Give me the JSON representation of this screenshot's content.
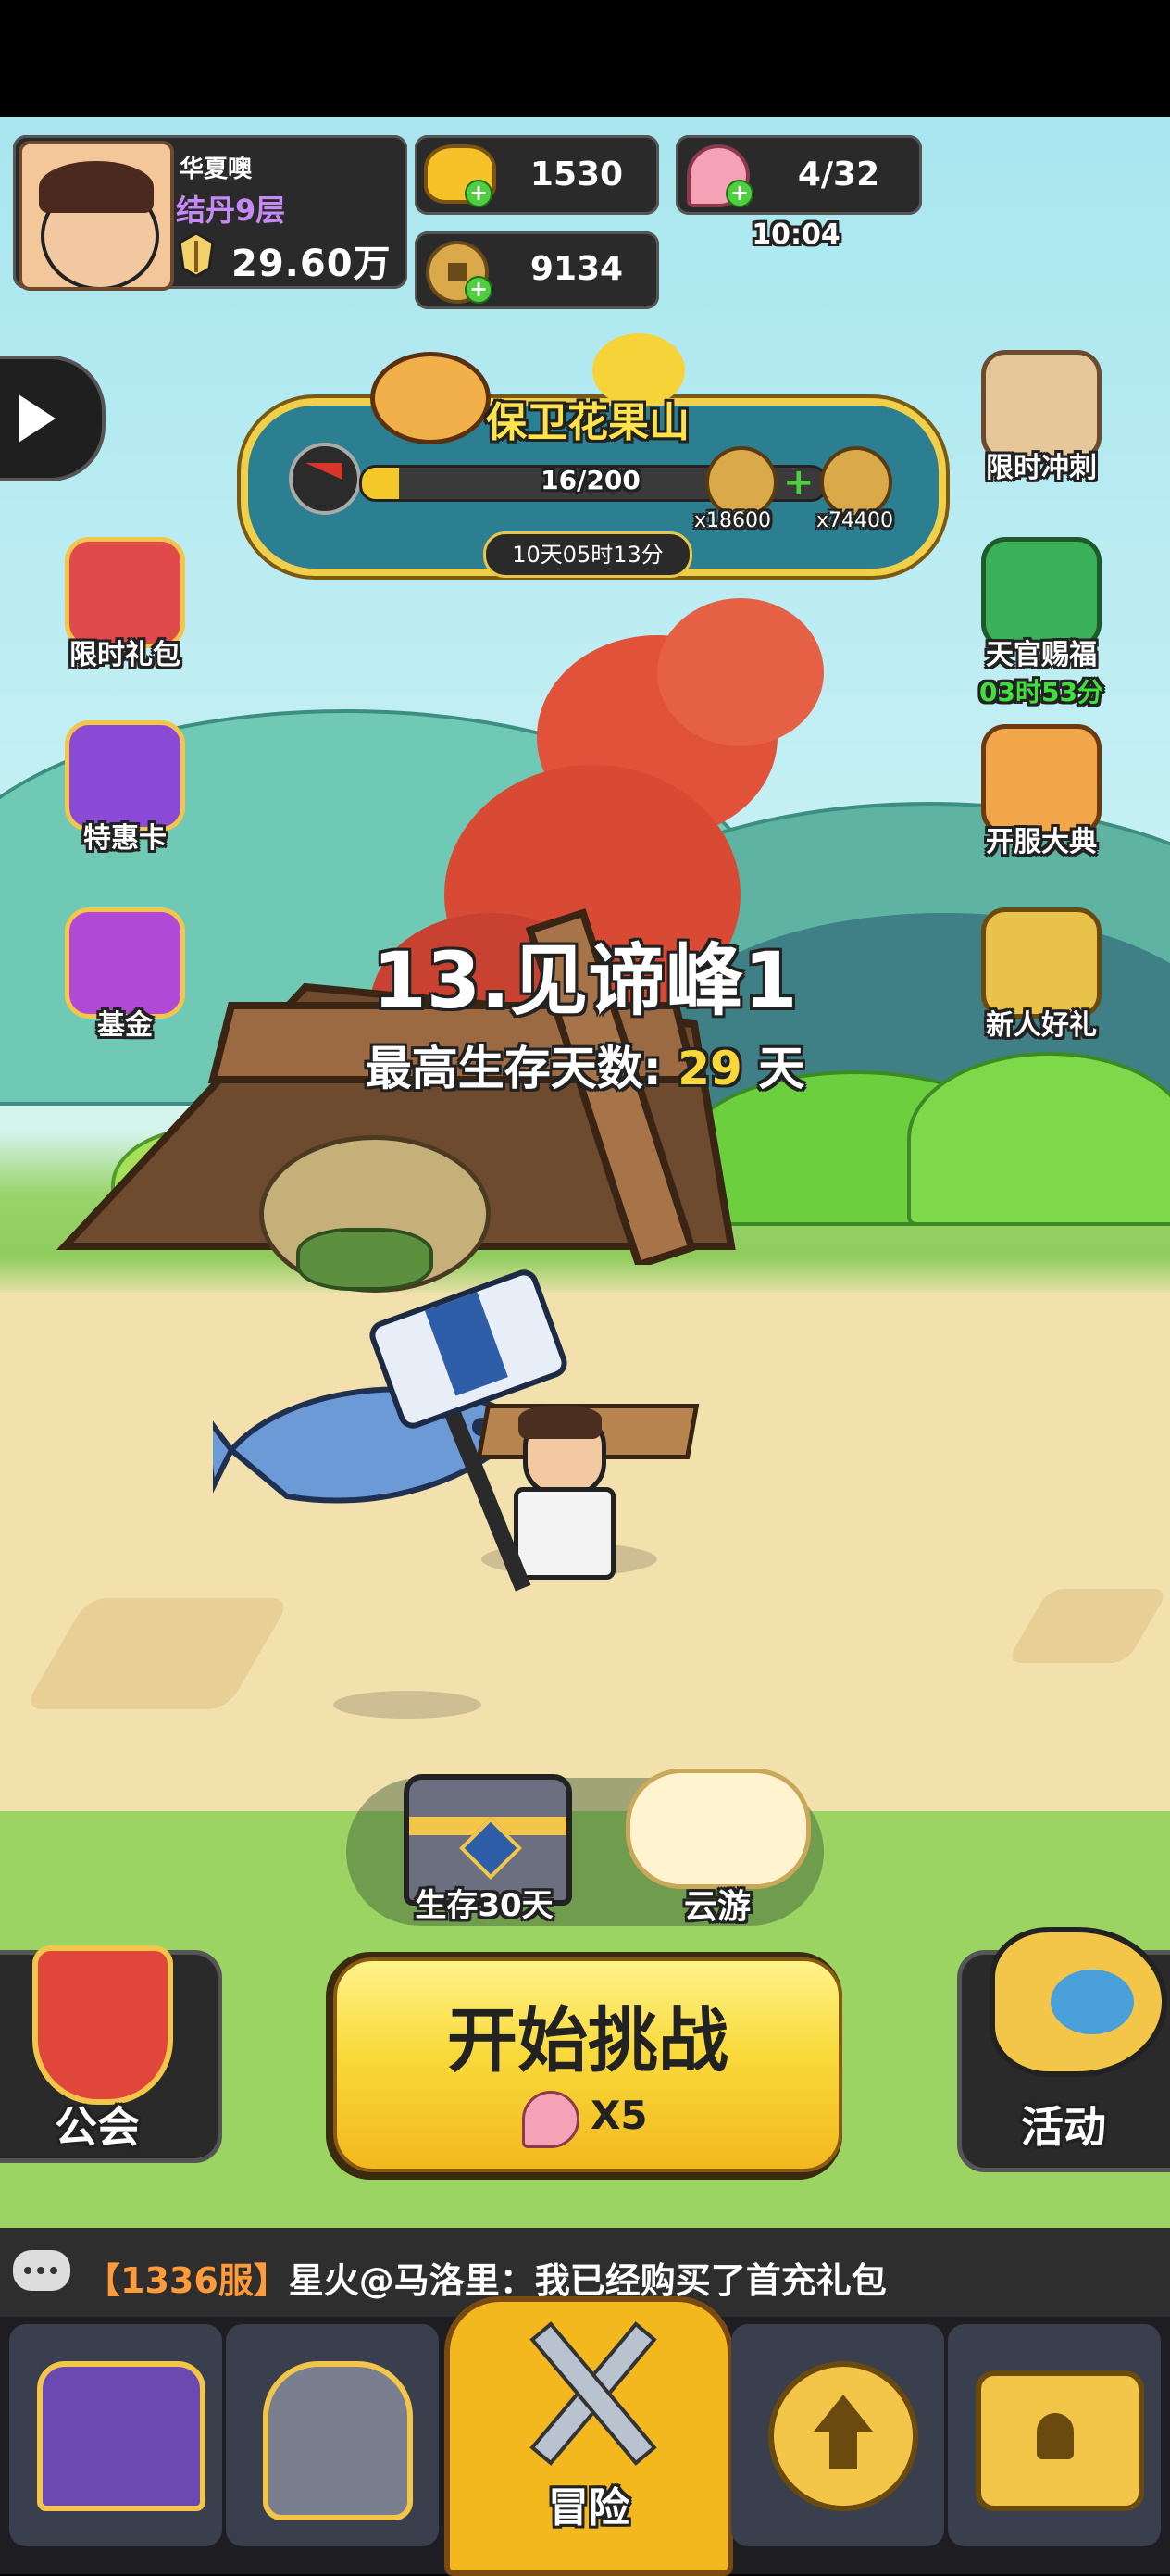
{
  "player": {
    "name": "华夏噢",
    "realm": "结丹9层",
    "power": "29.60万"
  },
  "resources": {
    "ingot": "1530",
    "coin": "9134",
    "peach": "4/32",
    "peach_timer": "10:04"
  },
  "event": {
    "title": "保卫花果山",
    "progress_text": "16/200",
    "progress": 0.08,
    "reward1": "x18600",
    "reward2": "x74400",
    "countdown": "10天05时13分"
  },
  "left_buttons": [
    {
      "label": "限时礼包"
    },
    {
      "label": "特惠卡"
    },
    {
      "label": "基金"
    }
  ],
  "right_buttons": [
    {
      "label": "限时冲刺"
    },
    {
      "label": "天官赐福",
      "timer": "03时53分"
    },
    {
      "label": "开服大典"
    },
    {
      "label": "新人好礼"
    }
  ],
  "stage": {
    "name": "13.见谛峰1",
    "survival_label": "最高生存天数:",
    "days": "29",
    "days_unit": "天"
  },
  "chest_label": "生存30天",
  "cloud_label": "云游",
  "guild_label": "公会",
  "start_button": {
    "label": "开始挑战",
    "cost": "X5"
  },
  "activity_label": "活动",
  "chat": {
    "server": "【1336服】",
    "message": "星火@马洛里：我已经购买了首充礼包"
  },
  "nav": {
    "active_label": "冒险"
  },
  "colors": {
    "gold": "#f9d93a",
    "purple": "#c58af5",
    "green": "#3fe03a",
    "chat_orange": "#ff9b3b"
  }
}
